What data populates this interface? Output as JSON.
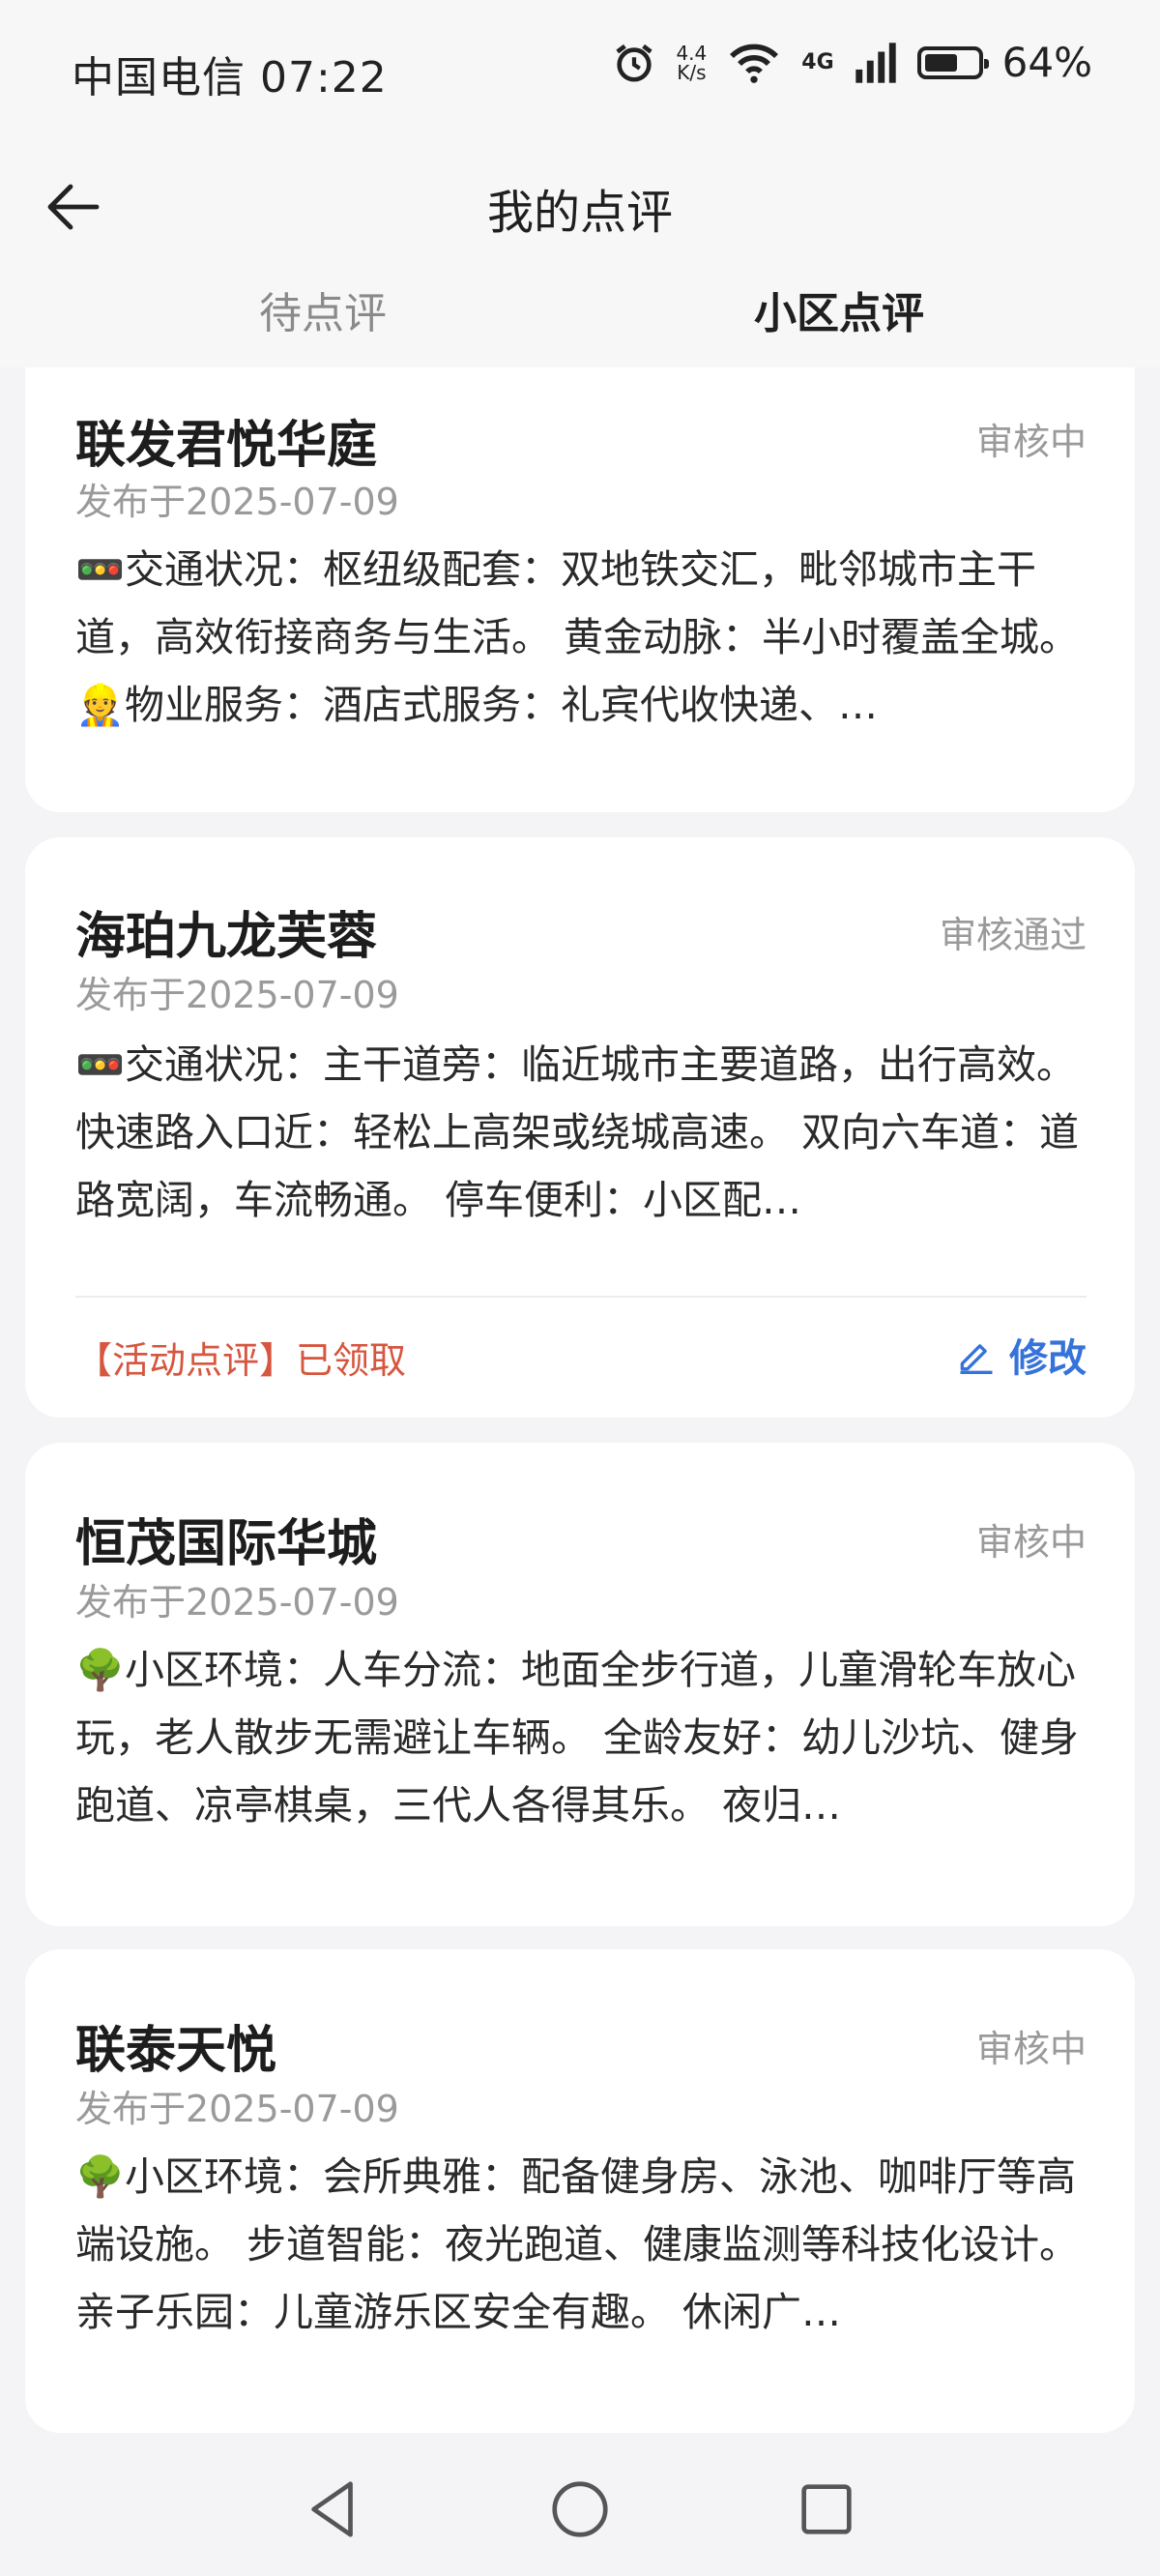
{
  "status_bar": {
    "carrier_time": "中国电信 07:22",
    "net_speed_top": "4.4",
    "net_speed_bottom": "K/s",
    "network": "4G",
    "battery": "64%",
    "battery_level": 0.64
  },
  "header": {
    "title": "我的点评"
  },
  "tabs": [
    {
      "label": "待点评"
    },
    {
      "label": "小区点评"
    }
  ],
  "reviews": [
    {
      "name": "联发君悦华庭",
      "status": "审核中",
      "date": "发布于2025-07-09",
      "content": "🚥交通状况：枢纽级配套：双地铁交汇，毗邻城市主干道，高效衔接商务与生活。 黄金动脉：半小时覆盖全城。 👷物业服务：酒店式服务：礼宾代收快递、…"
    },
    {
      "name": "海珀九龙芙蓉",
      "status": "审核通过",
      "date": "发布于2025-07-09",
      "content": "🚥交通状况：主干道旁：临近城市主要道路，出行高效。 快速路入口近：轻松上高架或绕城高速。 双向六车道：道路宽阔，车流畅通。 停车便利：小区配…",
      "activity": "【活动点评】已领取",
      "edit_label": "修改"
    },
    {
      "name": "恒茂国际华城",
      "status": "审核中",
      "date": "发布于2025-07-09",
      "content": "🌳小区环境：人车分流：地面全步行道，儿童滑轮车放心玩，老人散步无需避让车辆。 全龄友好：幼儿沙坑、健身跑道、凉亭棋桌，三代人各得其乐。 夜归…"
    },
    {
      "name": "联泰天悦",
      "status": "审核中",
      "date": "发布于2025-07-09",
      "content": "🌳小区环境：会所典雅：配备健身房、泳池、咖啡厅等高端设施。 步道智能：夜光跑道、健康监测等科技化设计。 亲子乐园：儿童游乐区安全有趣。 休闲广…"
    }
  ]
}
